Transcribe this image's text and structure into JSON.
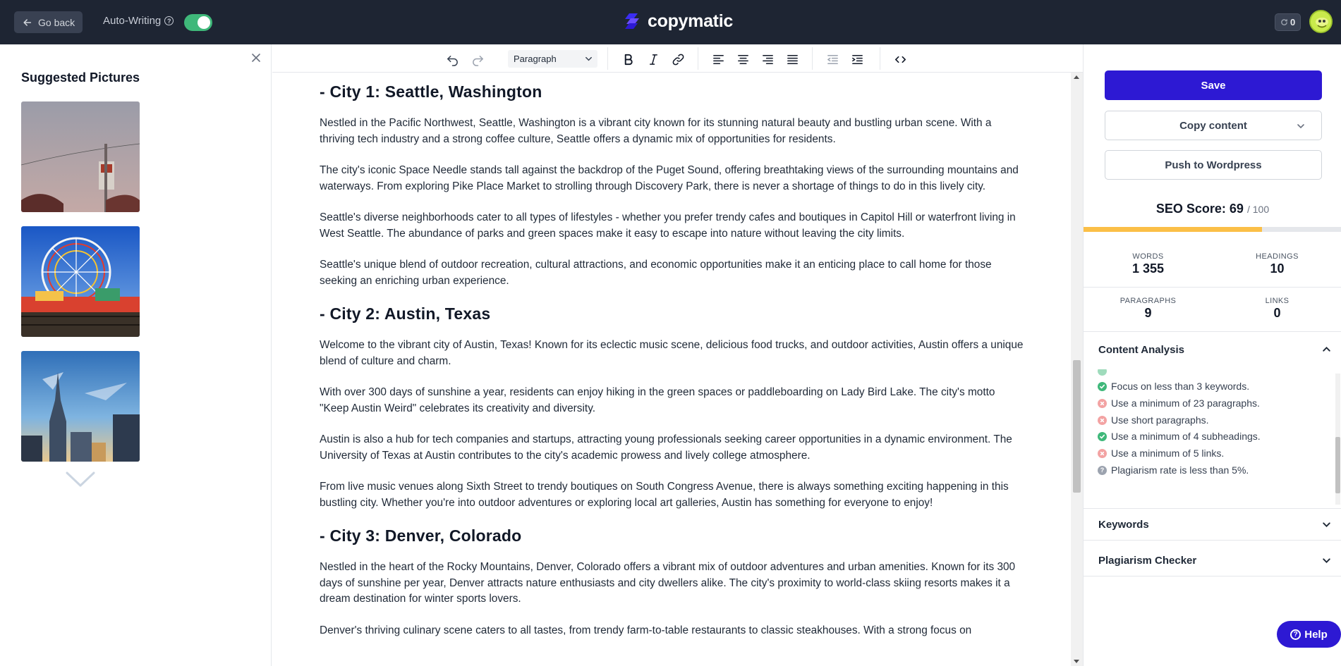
{
  "topbar": {
    "goback_label": "Go back",
    "autowriting_label": "Auto-Writing",
    "autowriting_enabled": true,
    "logo_text": "copymatic",
    "credits": "0",
    "accent": "#2d19d3",
    "bar_color": "#1e2533"
  },
  "left_panel": {
    "title": "Suggested Pictures",
    "pictures": [
      {
        "icon": "sign-photo"
      },
      {
        "icon": "ferris-wheel-photo"
      },
      {
        "icon": "city-tower-photo"
      }
    ]
  },
  "toolbar": {
    "block_format": "Paragraph",
    "icons": [
      "undo-icon",
      "redo-icon",
      "bold-icon",
      "italic-icon",
      "link-icon",
      "align-left-icon",
      "align-center-icon",
      "align-right-icon",
      "align-justify-icon",
      "outdent-icon",
      "indent-icon",
      "code-icon"
    ]
  },
  "editor": {
    "blocks": [
      {
        "type": "h2",
        "text": "- City 1: Seattle, Washington"
      },
      {
        "type": "p",
        "text": "Nestled in the Pacific Northwest, Seattle, Washington is a vibrant city known for its stunning natural beauty and bustling urban scene. With a thriving tech industry and a strong coffee culture, Seattle offers a dynamic mix of opportunities for residents."
      },
      {
        "type": "p",
        "text": "The city's iconic Space Needle stands tall against the backdrop of the Puget Sound, offering breathtaking views of the surrounding mountains and waterways. From exploring Pike Place Market to strolling through Discovery Park, there is never a shortage of things to do in this lively city."
      },
      {
        "type": "p",
        "text": "Seattle's diverse neighborhoods cater to all types of lifestyles - whether you prefer trendy cafes and boutiques in Capitol Hill or waterfront living in West Seattle. The abundance of parks and green spaces make it easy to escape into nature without leaving the city limits."
      },
      {
        "type": "p",
        "text": "Seattle's unique blend of outdoor recreation, cultural attractions, and economic opportunities make it an enticing place to call home for those seeking an enriching urban experience."
      },
      {
        "type": "h2",
        "text": "- City 2: Austin, Texas"
      },
      {
        "type": "p",
        "text": "Welcome to the vibrant city of Austin, Texas! Known for its eclectic music scene, delicious food trucks, and outdoor activities, Austin offers a unique blend of culture and charm."
      },
      {
        "type": "p",
        "text": "With over 300 days of sunshine a year, residents can enjoy hiking in the green spaces or paddleboarding on Lady Bird Lake. The city's motto \"Keep Austin Weird\" celebrates its creativity and diversity."
      },
      {
        "type": "p",
        "text": "Austin is also a hub for tech companies and startups, attracting young professionals seeking career opportunities in a dynamic environment. The University of Texas at Austin contributes to the city's academic prowess and lively college atmosphere."
      },
      {
        "type": "p",
        "text": "From live music venues along Sixth Street to trendy boutiques on South Congress Avenue, there is always something exciting happening in this bustling city. Whether you're into outdoor adventures or exploring local art galleries, Austin has something for everyone to enjoy!"
      },
      {
        "type": "h2",
        "text": "- City 3: Denver, Colorado"
      },
      {
        "type": "p",
        "text": "Nestled in the heart of the Rocky Mountains, Denver, Colorado offers a vibrant mix of outdoor adventures and urban amenities. Known for its 300 days of sunshine per year, Denver attracts nature enthusiasts and city dwellers alike. The city's proximity to world-class skiing resorts makes it a dream destination for winter sports lovers."
      },
      {
        "type": "p",
        "text": "Denver's thriving culinary scene caters to all tastes, from trendy farm-to-table restaurants to classic steakhouses. With a strong focus on"
      }
    ]
  },
  "right_panel": {
    "save_label": "Save",
    "copy_label": "Copy content",
    "push_label": "Push to Wordpress",
    "seo_label": "SEO Score: ",
    "seo_value": "69",
    "seo_max": "/ 100",
    "seo_fraction": 0.69,
    "seo_color": "#fbbf47",
    "stats": {
      "words_label": "WORDS",
      "words": "1 355",
      "headings_label": "HEADINGS",
      "headings": "10",
      "paragraphs_label": "PARAGRAPHS",
      "paragraphs": "9",
      "links_label": "LINKS",
      "links": "0"
    },
    "content_analysis_title": "Content Analysis",
    "analysis_items": [
      {
        "status": "ok",
        "text": "Focus on less than 3 keywords."
      },
      {
        "status": "bad",
        "text": "Use a minimum of 23 paragraphs."
      },
      {
        "status": "bad",
        "text": "Use short paragraphs."
      },
      {
        "status": "ok",
        "text": "Use a minimum of 4 subheadings."
      },
      {
        "status": "bad",
        "text": "Use a minimum of 5 links."
      },
      {
        "status": "neutral",
        "text": "Plagiarism rate is less than 5%."
      }
    ],
    "keywords_title": "Keywords",
    "plagiarism_title": "Plagiarism Checker"
  },
  "help_label": "Help"
}
